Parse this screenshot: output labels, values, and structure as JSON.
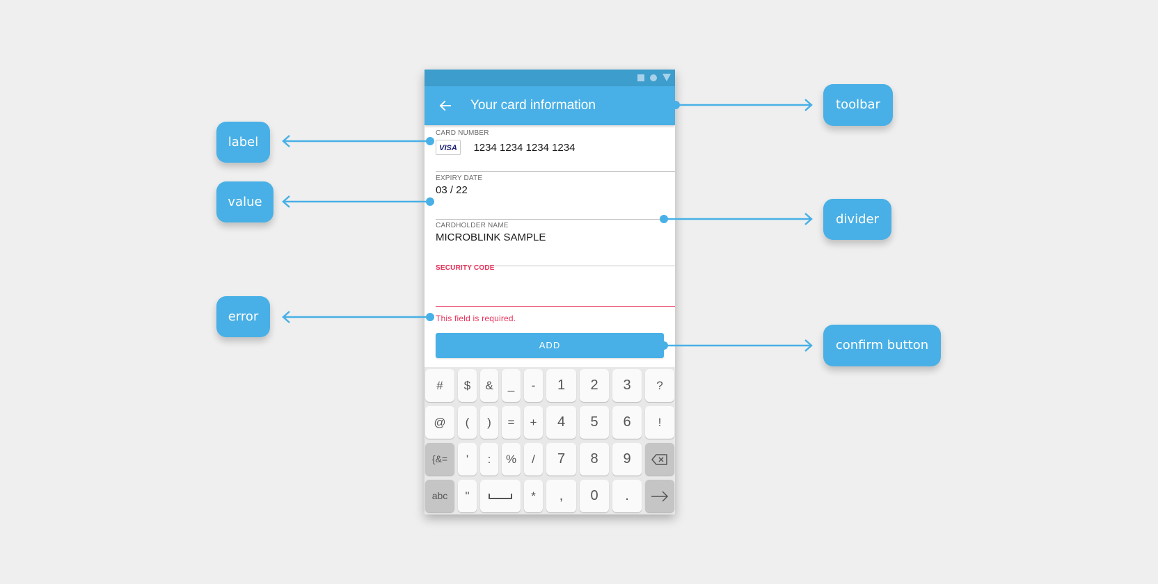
{
  "phone": {
    "status_icons": [
      "square-icon",
      "circle-icon",
      "triangle-icon"
    ],
    "toolbar": {
      "back_icon": "arrow-left-icon",
      "title": "Your card information"
    },
    "fields": {
      "card_number": {
        "label": "CARD NUMBER",
        "brand": "VISA",
        "value": "1234 1234 1234 1234"
      },
      "expiry": {
        "label": "EXPIRY DATE",
        "value": "03 / 22"
      },
      "cardholder": {
        "label": "CARDHOLDER NAME",
        "value": "MICROBLINK SAMPLE"
      },
      "security": {
        "label": "SECURITY CODE",
        "value": "",
        "error": "This field is required."
      }
    },
    "add_button": "ADD",
    "keyboard": {
      "rows": [
        [
          "#",
          "$",
          "&",
          "_",
          "-",
          "1",
          "2",
          "3",
          "?"
        ],
        [
          "@",
          "(",
          ")",
          "=",
          "+",
          "4",
          "5",
          "6",
          "!"
        ],
        [
          "{&=",
          "'",
          ":",
          "%",
          "/",
          "7",
          "8",
          "9",
          "backspace"
        ],
        [
          "abc",
          "\"",
          "space",
          "*",
          ",",
          "0",
          ".",
          "enter"
        ]
      ]
    }
  },
  "annotations": {
    "toolbar": "toolbar",
    "label": "label",
    "value": "value",
    "divider": "divider",
    "error": "error",
    "confirm_button": "confirm button"
  },
  "colors": {
    "accent": "#48b0e6",
    "status_bar": "#3d9dcc",
    "error": "#e8325a",
    "background": "#efefef"
  }
}
